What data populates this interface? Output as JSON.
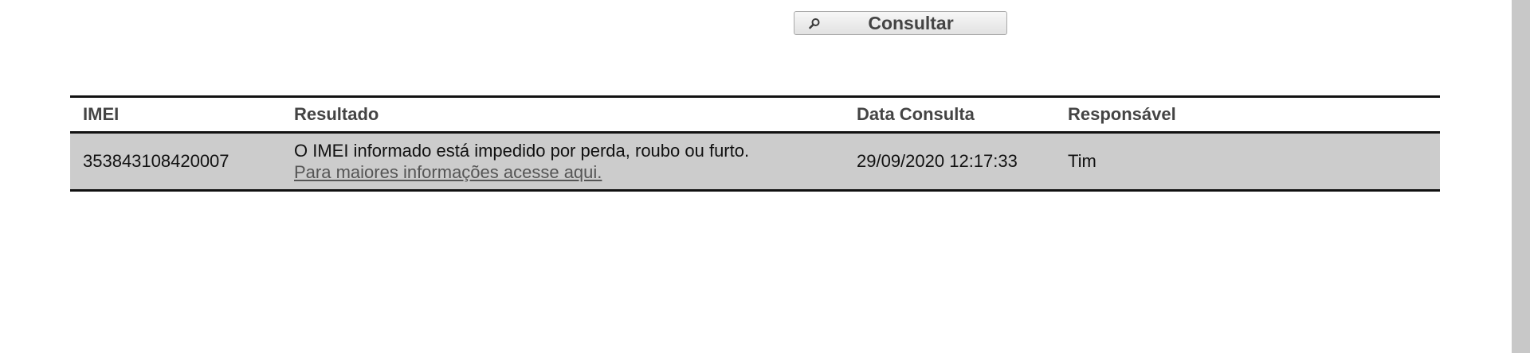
{
  "consult_button": {
    "label": "Consultar",
    "icon": "magnifier-icon"
  },
  "table": {
    "headers": {
      "imei": "IMEI",
      "result": "Resultado",
      "date": "Data Consulta",
      "responsible": "Responsável"
    },
    "rows": [
      {
        "imei": "353843108420007",
        "result": "O IMEI informado está impedido por perda, roubo ou furto.",
        "result_link": "Para maiores informações acesse aqui.",
        "date": "29/09/2020 12:17:33",
        "responsible": "Tim"
      }
    ]
  }
}
